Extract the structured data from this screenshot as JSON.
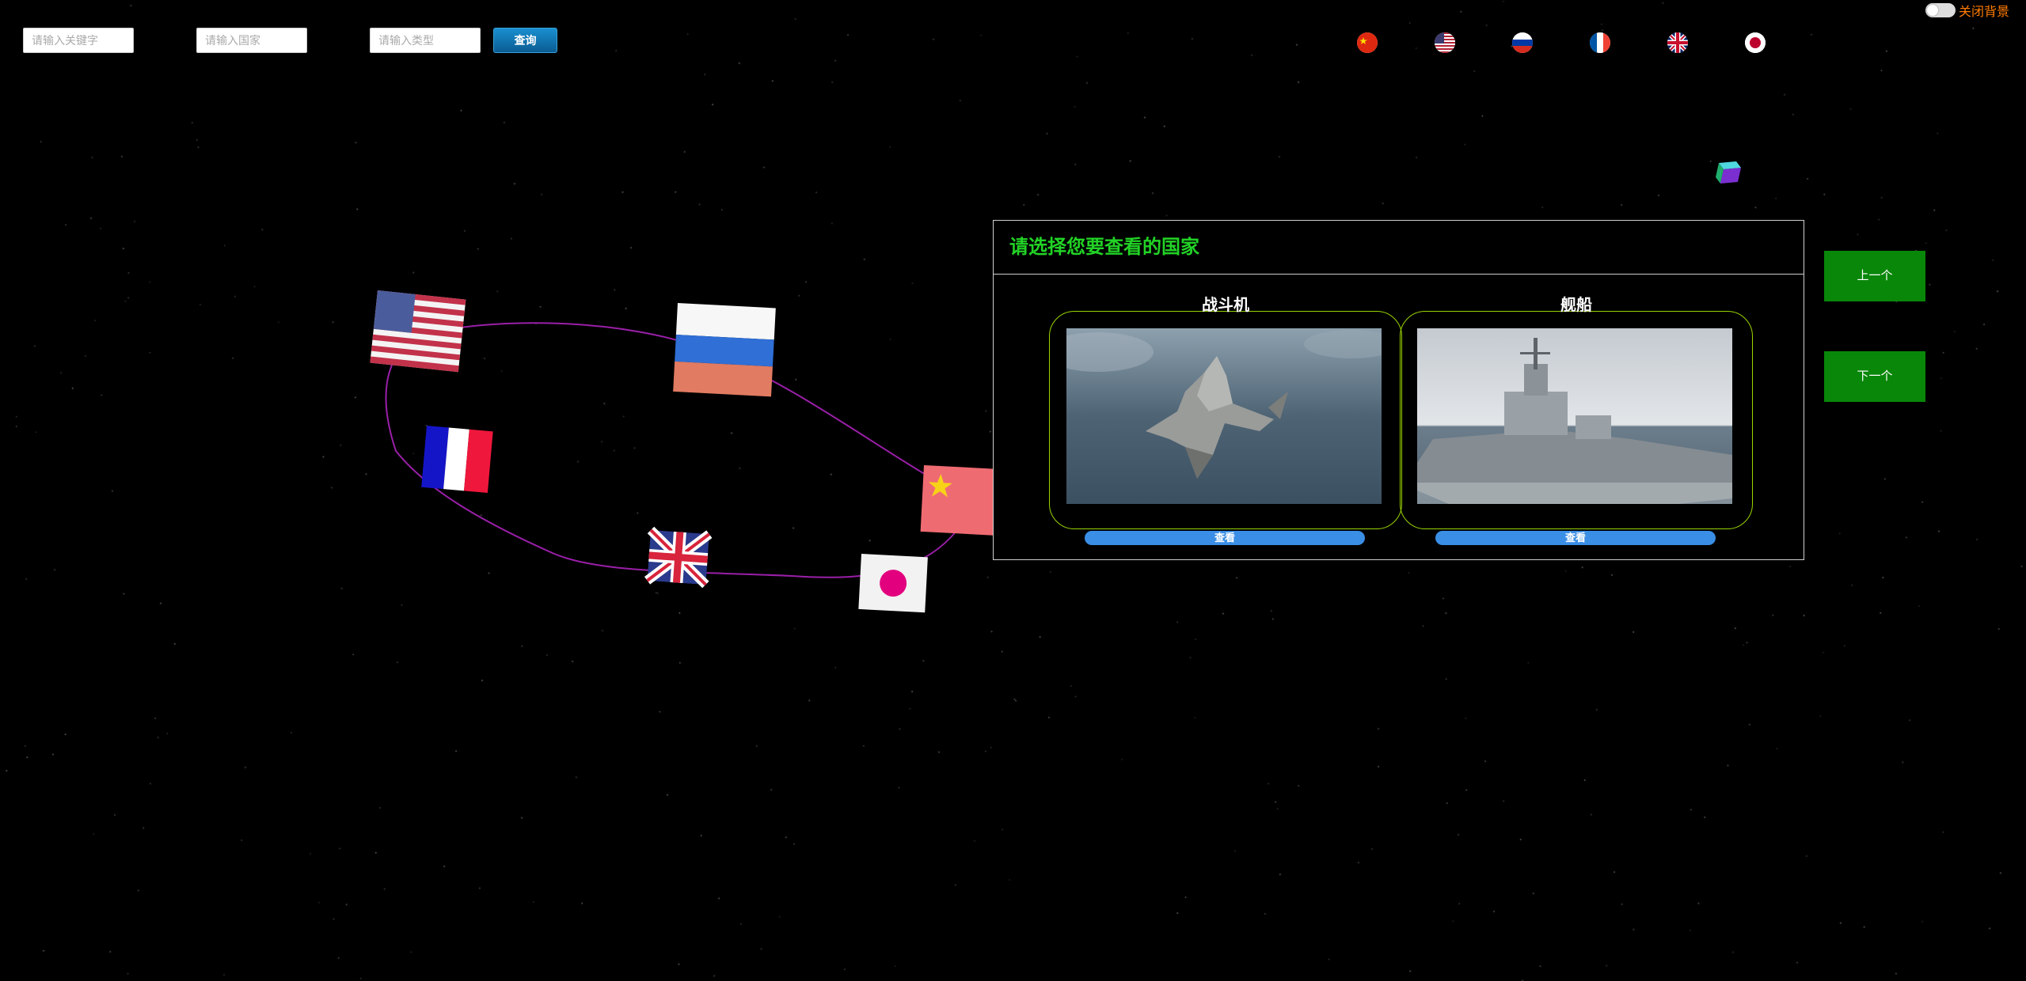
{
  "background": {
    "color": "#000000",
    "star_color": "#8a8a8a"
  },
  "search": {
    "keyword_placeholder": "请输入关键字",
    "country_placeholder": "请输入国家",
    "type_placeholder": "请输入类型",
    "query_label": "查询"
  },
  "flag_bar": [
    {
      "name": "china-flag-icon",
      "country": "china"
    },
    {
      "name": "usa-flag-icon",
      "country": "usa"
    },
    {
      "name": "russia-flag-icon",
      "country": "russia"
    },
    {
      "name": "france-flag-icon",
      "country": "france"
    },
    {
      "name": "uk-flag-icon",
      "country": "uk"
    },
    {
      "name": "japan-flag-icon",
      "country": "japan"
    }
  ],
  "background_toggle": {
    "label": "关闭背景",
    "on": false
  },
  "orbit": {
    "flags": [
      "usa",
      "russia",
      "france",
      "china",
      "uk",
      "japan"
    ],
    "ring_color": "#9a1fa8"
  },
  "panel": {
    "title": "请选择您要查看的国家",
    "title_color": "#22d326",
    "categories": [
      {
        "title": "战斗机",
        "image": "fighter-jet-image",
        "view_label": "查看"
      },
      {
        "title": "舰船",
        "image": "warship-image",
        "view_label": "查看"
      }
    ]
  },
  "nav": {
    "prev_label": "上一个",
    "next_label": "下一个",
    "color": "#098709"
  },
  "colors": {
    "accent_green": "#22d326",
    "card_border": "#9ad400",
    "view_button": "#3a8ee6",
    "toggle_label": "#ff7b00"
  }
}
